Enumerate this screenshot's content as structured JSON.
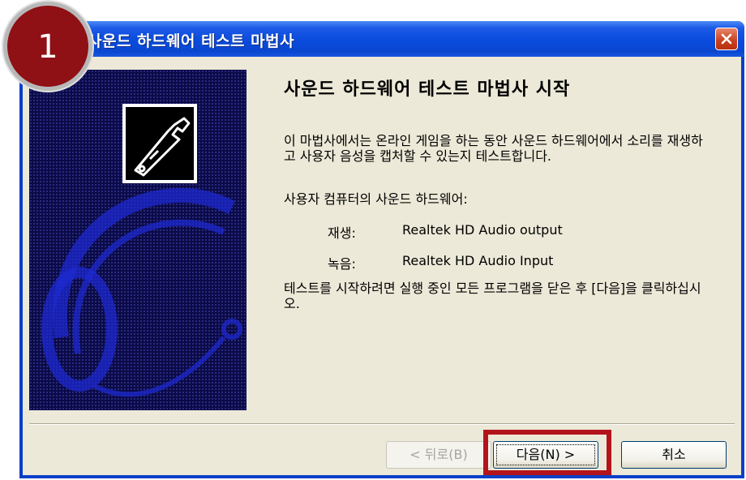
{
  "window": {
    "title": "사운드 하드웨어 테스트 마법사"
  },
  "wizard": {
    "heading": "사운드 하드웨어 테스트 마법사 시작",
    "description": "이 마법사에서는 온라인 게임을 하는 동안 사운드 하드웨어에서 소리를 재생하고 사용자 음성을 캡처할 수 있는지 테스트합니다.",
    "hardware_label": "사용자 컴퓨터의 사운드 하드웨어:",
    "devices": [
      {
        "label": "재생:",
        "value": "Realtek HD Audio output"
      },
      {
        "label": "녹음:",
        "value": "Realtek HD Audio Input"
      }
    ],
    "instruction": "테스트를 시작하려면 실행 중인 모든 프로그램을 닫은 후 [다음]을 클릭하십시오."
  },
  "buttons": {
    "back": "< 뒤로(B)",
    "next": "다음(N) >",
    "cancel": "취소"
  },
  "annotation": {
    "step_number": "1",
    "highlight_color": "#b3141b"
  },
  "colors": {
    "titlebar": "#0a4bdd",
    "dialog_bg": "#ece9d8",
    "art_bg": "#0a0a46"
  },
  "icons": [
    "close-icon",
    "wrench-icon",
    "headset-illustration"
  ]
}
